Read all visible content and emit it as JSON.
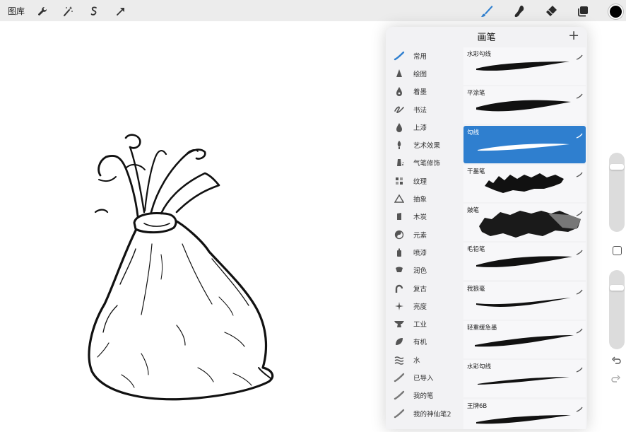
{
  "topbar": {
    "gallery_label": "图库",
    "left_tools": [
      "wrench-icon",
      "magic-wand-icon",
      "selection-icon",
      "transform-arrow-icon"
    ],
    "right_tools": [
      "brush-icon",
      "smudge-icon",
      "eraser-icon",
      "layers-icon",
      "color-icon"
    ],
    "accent_color": "#2f7fcf",
    "current_color": "#000000"
  },
  "brush_panel": {
    "title": "画笔",
    "add_icon": "+",
    "sets": [
      {
        "label": "常用",
        "icon": "stroke-icon"
      },
      {
        "label": "绘图",
        "icon": "pencil-tip-icon"
      },
      {
        "label": "着墨",
        "icon": "ink-drop-icon"
      },
      {
        "label": "书法",
        "icon": "calligraphy-icon"
      },
      {
        "label": "上漆",
        "icon": "paint-drop-icon"
      },
      {
        "label": "艺术效果",
        "icon": "art-brush-icon"
      },
      {
        "label": "气笔修饰",
        "icon": "airbrush-icon"
      },
      {
        "label": "纹理",
        "icon": "texture-icon"
      },
      {
        "label": "抽象",
        "icon": "triangle-icon"
      },
      {
        "label": "木炭",
        "icon": "charcoal-icon"
      },
      {
        "label": "元素",
        "icon": "yin-yang-icon"
      },
      {
        "label": "喷漆",
        "icon": "spray-can-icon"
      },
      {
        "label": "润色",
        "icon": "retouch-icon"
      },
      {
        "label": "复古",
        "icon": "retro-icon"
      },
      {
        "label": "亮度",
        "icon": "sparkle-icon"
      },
      {
        "label": "工业",
        "icon": "anvil-icon"
      },
      {
        "label": "有机",
        "icon": "leaf-icon"
      },
      {
        "label": "水",
        "icon": "waves-icon"
      },
      {
        "label": "已导入",
        "icon": "stroke-icon"
      },
      {
        "label": "我的笔",
        "icon": "stroke-icon"
      },
      {
        "label": "我的神仙笔2",
        "icon": "stroke-icon"
      }
    ],
    "brushes": [
      {
        "name": "水彩勾线",
        "selected": false
      },
      {
        "name": "平涂笔",
        "selected": false
      },
      {
        "name": "勾线",
        "selected": true
      },
      {
        "name": "干墨笔",
        "selected": false
      },
      {
        "name": "皴笔",
        "selected": false
      },
      {
        "name": "毛铅笔",
        "selected": false
      },
      {
        "name": "我狼毫",
        "selected": false
      },
      {
        "name": "轻重缓急墨",
        "selected": false
      },
      {
        "name": "水彩勾线",
        "selected": false
      },
      {
        "name": "王牌6B",
        "selected": false
      }
    ]
  },
  "sidebar": {
    "brush_size_level": 0.85,
    "opacity_level": 0.8,
    "modify_button": "square-icon",
    "undo_icon": "undo-icon",
    "redo_icon": "redo-icon"
  },
  "canvas": {
    "drawing": "ink sketch of a tied cloth bag"
  }
}
